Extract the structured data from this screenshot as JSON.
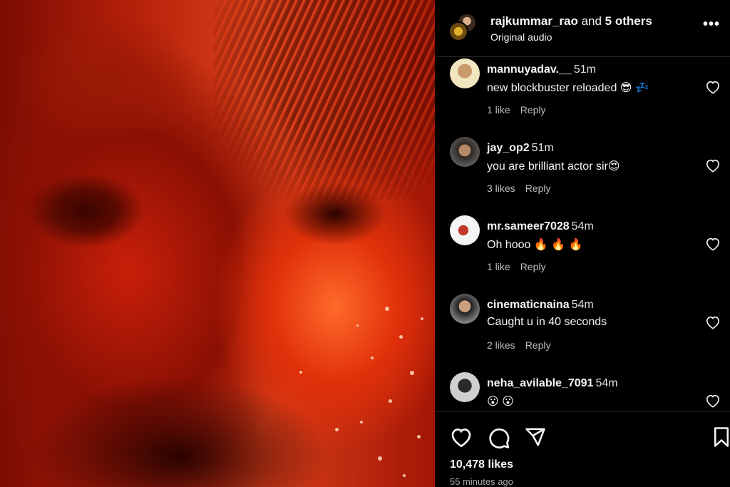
{
  "header": {
    "user": "rajkummar_rao",
    "and_text": " and ",
    "others": "5 others",
    "audio": "Original audio",
    "more_label": "•••"
  },
  "comments": [
    {
      "username": "mannuyadav.__",
      "time": "51m",
      "text": "new blockbuster reloaded 😎 💤",
      "likes": "1 like",
      "reply": "Reply",
      "avatar_colors": [
        "#f2e6c0",
        "#c99a6a"
      ]
    },
    {
      "username": "jay_op2",
      "time": "51m",
      "text": "you are brilliant actor sir😍",
      "likes": "3 likes",
      "reply": "Reply",
      "avatar_colors": [
        "#5a5a5a",
        "#2e2620"
      ]
    },
    {
      "username": "mr.sameer7028",
      "time": "54m",
      "text": "Oh hooo 🔥 🔥 🔥",
      "likes": "1 like",
      "reply": "Reply",
      "avatar_colors": [
        "#f5f5f5",
        "#c0392b"
      ]
    },
    {
      "username": "cinematicnaina",
      "time": "54m",
      "text": "Caught u in 40 seconds",
      "likes": "2 likes",
      "reply": "Reply",
      "avatar_colors": [
        "#8a8a8a",
        "#1e1e1e"
      ]
    },
    {
      "username": "neha_avilable_7091",
      "time": "54m",
      "text": "😮 😮",
      "likes": "",
      "reply": "",
      "avatar_colors": [
        "#cfcfcf",
        "#2a2a2a"
      ]
    }
  ],
  "footer": {
    "likes": "10,478 likes",
    "time_ago": "55 minutes ago"
  },
  "icons": {
    "like": "heart-icon",
    "comment": "comment-bubble-icon",
    "share": "paper-plane-icon",
    "save": "bookmark-icon",
    "comment_like": "heart-outline-icon"
  }
}
